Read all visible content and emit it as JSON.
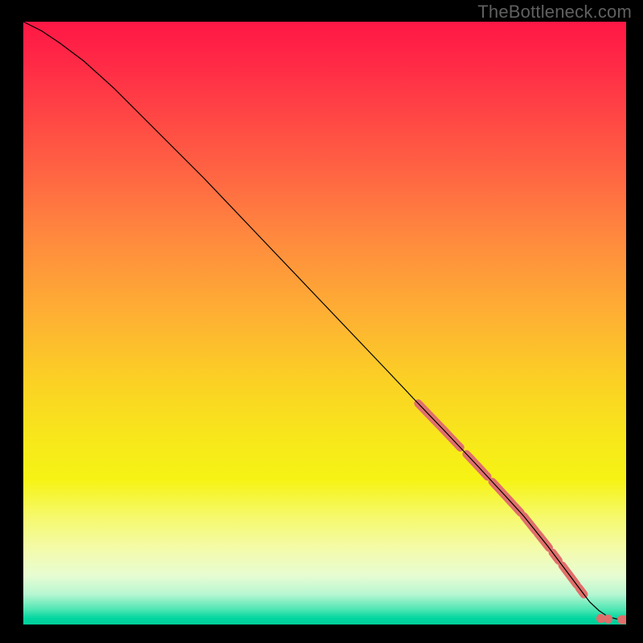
{
  "watermark": "TheBottleneck.com",
  "chart_data": {
    "type": "line",
    "title": "",
    "xlabel": "",
    "ylabel": "",
    "xlim": [
      0,
      100
    ],
    "ylim": [
      0,
      100
    ],
    "grid": false,
    "legend": "none",
    "series": [
      {
        "name": "curve",
        "x": [
          0,
          3,
          6,
          10,
          15,
          20,
          30,
          40,
          50,
          60,
          65,
          70,
          75,
          80,
          83,
          85,
          87,
          88.5,
          90,
          91.5,
          93,
          94,
          95.5,
          97,
          98.5,
          100
        ],
        "y": [
          100,
          98.5,
          96.5,
          93.5,
          89,
          84,
          74,
          63.5,
          53,
          42.5,
          37.2,
          32,
          26.7,
          21.3,
          18,
          15.5,
          13,
          11,
          9,
          7,
          5,
          3.7,
          2.3,
          1.3,
          0.9,
          0.8
        ]
      }
    ],
    "highlighted_segments": [
      {
        "x0": 65.5,
        "x1": 72.5
      },
      {
        "x0": 73.5,
        "x1": 77.0
      },
      {
        "x0": 77.8,
        "x1": 82.5
      },
      {
        "x0": 83.0,
        "x1": 85.0
      },
      {
        "x0": 85.3,
        "x1": 87.2
      },
      {
        "x0": 87.8,
        "x1": 88.8
      },
      {
        "x0": 89.4,
        "x1": 91.8
      },
      {
        "x0": 92.2,
        "x1": 93.0
      }
    ],
    "highlighted_flat_dots": [
      {
        "x": 95.8,
        "y": 1.0
      },
      {
        "x": 97.0,
        "y": 0.9
      },
      {
        "x": 99.3,
        "y": 0.8
      },
      {
        "x": 100.0,
        "y": 0.8
      }
    ],
    "gradient_stops": [
      {
        "pct": 0,
        "color": "#ff1745"
      },
      {
        "pct": 25,
        "color": "#ff6443"
      },
      {
        "pct": 48,
        "color": "#feae34"
      },
      {
        "pct": 70,
        "color": "#f7e91a"
      },
      {
        "pct": 88,
        "color": "#f3fbb0"
      },
      {
        "pct": 95,
        "color": "#b6f7d2"
      },
      {
        "pct": 100,
        "color": "#00cf9a"
      }
    ],
    "colors": {
      "curve": "#000000",
      "highlight": "#e06f6b",
      "watermark": "#606060",
      "frame": "#000000"
    }
  }
}
